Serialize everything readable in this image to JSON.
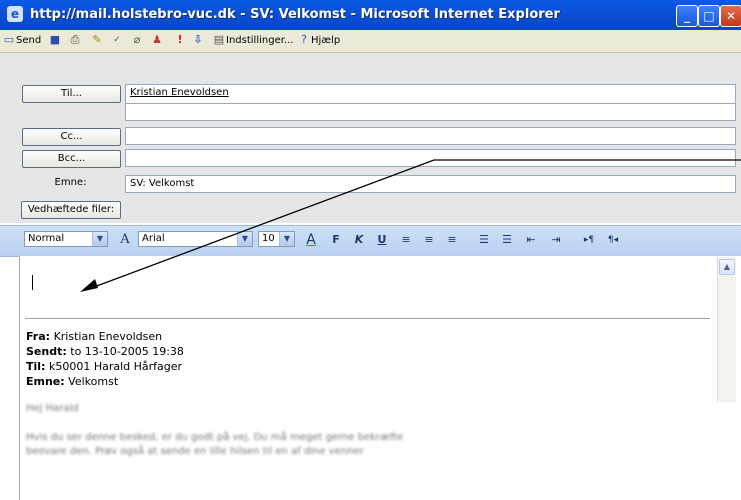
{
  "window": {
    "title": "http://mail.holstebro-vuc.dk - SV: Velkomst - Microsoft Internet Explorer",
    "controls": [
      "minimize",
      "maximize",
      "close"
    ]
  },
  "toolbar": {
    "send_label": "Send",
    "settings_label": "Indstillinger...",
    "help_label": "Hjælp"
  },
  "header": {
    "to_label": "Til...",
    "to_value": "Kristian Enevoldsen",
    "cc_label": "Cc...",
    "cc_value": "",
    "bcc_label": "Bcc...",
    "bcc_value": "",
    "subject_label": "Emne:",
    "subject_value": "SV: Velkomst",
    "attachments_label": "Vedhæftede filer:"
  },
  "format_bar": {
    "style": "Normal",
    "font": "Arial",
    "size": "10",
    "text_color_letter": "A",
    "bold": "F",
    "italic": "K",
    "underline": "U"
  },
  "body": {
    "quote": {
      "from_label": "Fra:",
      "from_value": "Kristian Enevoldsen",
      "sent_label": "Sendt:",
      "sent_value": "to 13-10-2005 19:38",
      "to_label": "Til:",
      "to_value": "k50001 Harald Hårfager",
      "subject_label": "Emne:",
      "subject_value": "Velkomst"
    },
    "blurred_lines": [
      "Hej Harald",
      "Hvis du ser denne besked, er du godt på vej. Du må meget gerne bekræfte",
      "beovare den. Prøv også at sende en lille hilsen til en af dine venner"
    ]
  },
  "colors": {
    "titlebar": "#0c4fd6",
    "toolbar": "#ece9d8",
    "format_bar": "#c4d8f5",
    "header": "#e6e6e6",
    "text_color_swatch": "#e8401c"
  }
}
